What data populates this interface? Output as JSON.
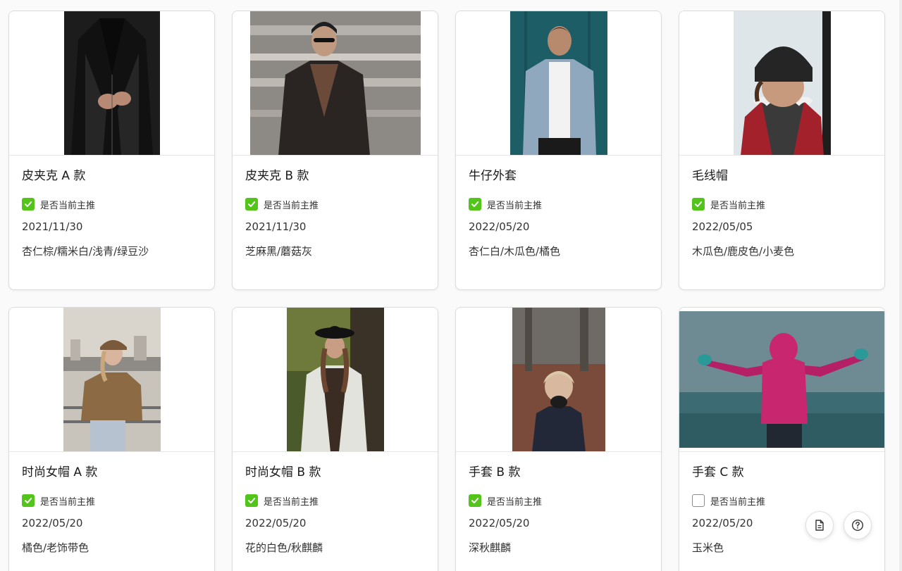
{
  "checkbox_label": "是否当前主推",
  "accent_color": "#52c41a",
  "products": [
    {
      "title": "皮夹克 A 款",
      "featured": true,
      "date": "2021/11/30",
      "colors": "杏仁棕/糯米白/浅青/绿豆沙",
      "image": "man-black-leather-jacket"
    },
    {
      "title": "皮夹克 B 款",
      "featured": true,
      "date": "2021/11/30",
      "colors": "芝麻黑/蘑菇灰",
      "image": "man-leather-jacket-sunglasses"
    },
    {
      "title": "牛仔外套",
      "featured": true,
      "date": "2022/05/20",
      "colors": "杏仁白/木瓜色/橘色",
      "image": "man-denim-jacket-teal-door"
    },
    {
      "title": "毛线帽",
      "featured": true,
      "date": "2022/05/05",
      "colors": "木瓜色/鹿皮色/小麦色",
      "image": "child-knit-beanie"
    },
    {
      "title": "时尚女帽 A 款",
      "featured": true,
      "date": "2022/05/20",
      "colors": "橘色/老饰带色",
      "image": "woman-newsboy-cap-sweater"
    },
    {
      "title": "时尚女帽 B 款",
      "featured": true,
      "date": "2022/05/20",
      "colors": "花的白色/秋麒麟",
      "image": "woman-hat-white-coat-forest"
    },
    {
      "title": "手套 B 款",
      "featured": true,
      "date": "2022/05/20",
      "colors": "深秋麒麟",
      "image": "child-gloves-autumn"
    },
    {
      "title": "手套 C 款",
      "featured": false,
      "date": "2022/05/20",
      "colors": "玉米色",
      "image": "child-pink-hoodie-arms-out"
    }
  ],
  "fab": {
    "doc": "document-icon",
    "help": "help-icon"
  }
}
